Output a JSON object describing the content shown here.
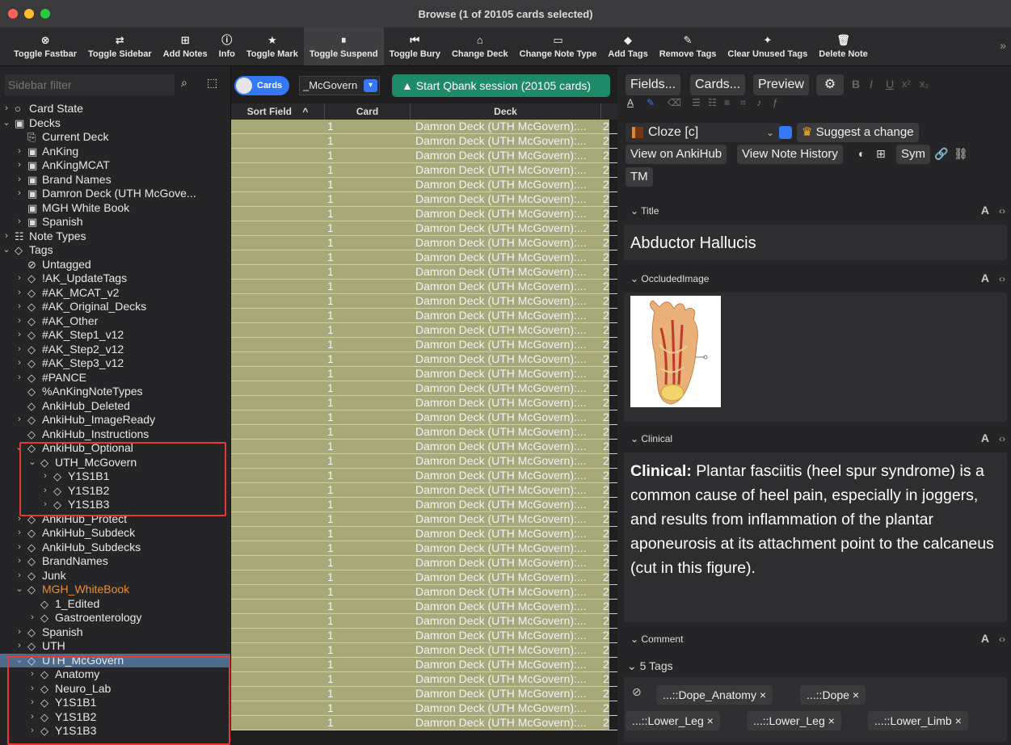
{
  "window": {
    "title": "Browse (1 of 20105 cards selected)"
  },
  "toolbar": {
    "items": [
      {
        "label": "Toggle Fastbar",
        "icon": "x-circle-icon"
      },
      {
        "label": "Toggle Sidebar",
        "icon": "swap-arrows-icon"
      },
      {
        "label": "Add Notes",
        "icon": "plus-square-icon"
      },
      {
        "label": "Info",
        "icon": "info-icon"
      },
      {
        "label": "Toggle Mark",
        "icon": "star-icon"
      },
      {
        "label": "Toggle Suspend",
        "icon": "pause-circle-icon"
      },
      {
        "label": "Toggle Bury",
        "icon": "skip-back-icon"
      },
      {
        "label": "Change Deck",
        "icon": "inbox-icon"
      },
      {
        "label": "Change Note Type",
        "icon": "note-type-icon"
      },
      {
        "label": "Add Tags",
        "icon": "tag-icon"
      },
      {
        "label": "Remove Tags",
        "icon": "eraser-icon"
      },
      {
        "label": "Clear Unused Tags",
        "icon": "magic-wand-icon"
      },
      {
        "label": "Delete Note",
        "icon": "trash-icon"
      }
    ]
  },
  "sidebar": {
    "filter_placeholder": "Sidebar filter",
    "items": [
      {
        "label": "Card State",
        "depth": 0,
        "chev": "right",
        "icon": "circle-icon"
      },
      {
        "label": "Decks",
        "depth": 0,
        "chev": "down",
        "icon": "deck-icon"
      },
      {
        "label": "Current Deck",
        "depth": 1,
        "chev": "",
        "icon": "current-deck-icon"
      },
      {
        "label": "AnKing",
        "depth": 1,
        "chev": "right",
        "icon": "deck-icon"
      },
      {
        "label": "AnKingMCAT",
        "depth": 1,
        "chev": "right",
        "icon": "deck-icon"
      },
      {
        "label": "Brand Names",
        "depth": 1,
        "chev": "right",
        "icon": "deck-icon"
      },
      {
        "label": "Damron Deck (UTH McGove...",
        "depth": 1,
        "chev": "right",
        "icon": "deck-icon"
      },
      {
        "label": "MGH White Book",
        "depth": 1,
        "chev": "",
        "icon": "deck-icon"
      },
      {
        "label": "Spanish",
        "depth": 1,
        "chev": "right",
        "icon": "deck-icon"
      },
      {
        "label": "Note Types",
        "depth": 0,
        "chev": "right",
        "icon": "note-types-icon"
      },
      {
        "label": "Tags",
        "depth": 0,
        "chev": "down",
        "icon": "tag-icon"
      },
      {
        "label": "Untagged",
        "depth": 1,
        "chev": "",
        "icon": "untagged-icon"
      },
      {
        "label": "!AK_UpdateTags",
        "depth": 1,
        "chev": "right",
        "icon": "tag-icon"
      },
      {
        "label": "#AK_MCAT_v2",
        "depth": 1,
        "chev": "right",
        "icon": "tag-icon"
      },
      {
        "label": "#AK_Original_Decks",
        "depth": 1,
        "chev": "right",
        "icon": "tag-icon"
      },
      {
        "label": "#AK_Other",
        "depth": 1,
        "chev": "right",
        "icon": "tag-icon"
      },
      {
        "label": "#AK_Step1_v12",
        "depth": 1,
        "chev": "right",
        "icon": "tag-icon"
      },
      {
        "label": "#AK_Step2_v12",
        "depth": 1,
        "chev": "right",
        "icon": "tag-icon"
      },
      {
        "label": "#AK_Step3_v12",
        "depth": 1,
        "chev": "right",
        "icon": "tag-icon"
      },
      {
        "label": "#PANCE",
        "depth": 1,
        "chev": "right",
        "icon": "tag-icon"
      },
      {
        "label": "%AnKingNoteTypes",
        "depth": 1,
        "chev": "",
        "icon": "tag-icon"
      },
      {
        "label": "AnkiHub_Deleted",
        "depth": 1,
        "chev": "",
        "icon": "tag-icon"
      },
      {
        "label": "AnkiHub_ImageReady",
        "depth": 1,
        "chev": "right",
        "icon": "tag-icon"
      },
      {
        "label": "AnkiHub_Instructions",
        "depth": 1,
        "chev": "",
        "icon": "tag-icon"
      },
      {
        "label": "AnkiHub_Optional",
        "depth": 1,
        "chev": "down",
        "icon": "tag-icon"
      },
      {
        "label": "UTH_McGovern",
        "depth": 2,
        "chev": "down",
        "icon": "tag-icon"
      },
      {
        "label": "Y1S1B1",
        "depth": 3,
        "chev": "right",
        "icon": "tag-icon"
      },
      {
        "label": "Y1S1B2",
        "depth": 3,
        "chev": "right",
        "icon": "tag-icon"
      },
      {
        "label": "Y1S1B3",
        "depth": 3,
        "chev": "right",
        "icon": "tag-icon"
      },
      {
        "label": "AnkiHub_Protect",
        "depth": 1,
        "chev": "right",
        "icon": "tag-icon"
      },
      {
        "label": "AnkiHub_Subdeck",
        "depth": 1,
        "chev": "right",
        "icon": "tag-icon"
      },
      {
        "label": "AnkiHub_Subdecks",
        "depth": 1,
        "chev": "right",
        "icon": "tag-icon"
      },
      {
        "label": "BrandNames",
        "depth": 1,
        "chev": "right",
        "icon": "tag-icon"
      },
      {
        "label": "Junk",
        "depth": 1,
        "chev": "right",
        "icon": "tag-icon"
      },
      {
        "label": "MGH_WhiteBook",
        "depth": 1,
        "chev": "down",
        "icon": "tag-icon",
        "color": "orange"
      },
      {
        "label": "1_Edited",
        "depth": 2,
        "chev": "",
        "icon": "tag-icon"
      },
      {
        "label": "Gastroenterology",
        "depth": 2,
        "chev": "right",
        "icon": "tag-icon"
      },
      {
        "label": "Spanish",
        "depth": 1,
        "chev": "right",
        "icon": "tag-icon"
      },
      {
        "label": "UTH",
        "depth": 1,
        "chev": "right",
        "icon": "tag-icon"
      },
      {
        "label": "UTH_McGovern",
        "depth": 1,
        "chev": "down",
        "icon": "tag-icon",
        "selected": true
      },
      {
        "label": "Anatomy",
        "depth": 2,
        "chev": "right",
        "icon": "tag-icon"
      },
      {
        "label": "Neuro_Lab",
        "depth": 2,
        "chev": "right",
        "icon": "tag-icon"
      },
      {
        "label": "Y1S1B1",
        "depth": 2,
        "chev": "right",
        "icon": "tag-icon"
      },
      {
        "label": "Y1S1B2",
        "depth": 2,
        "chev": "right",
        "icon": "tag-icon"
      },
      {
        "label": "Y1S1B3",
        "depth": 2,
        "chev": "right",
        "icon": "tag-icon"
      }
    ]
  },
  "cardlist": {
    "toggle_label": "Cards",
    "search_value": "_McGovern",
    "qbank_label": "Start Qbank session (20105 cards)",
    "columns": [
      "Sort Field",
      "Card",
      "Deck"
    ],
    "sort_indicator": "^",
    "row_card": "1",
    "row_deck": "Damron Deck (UTH McGovern):...",
    "row_due": "2",
    "first_row_deck": "Damron Deck (UTH McGovern):...",
    "row_count": 42
  },
  "editor": {
    "buttons": {
      "fields": "Fields...",
      "cards": "Cards...",
      "preview": "Preview"
    },
    "note_type": "Cloze [c]",
    "suggest_label": "Suggest a change",
    "view_on_ankihub": "View on AnkiHub",
    "view_note_history": "View Note History",
    "sym_label": "Sym",
    "tm_label": "TM",
    "fields": [
      {
        "label": "Title",
        "content": "Abductor Hallucis"
      },
      {
        "label": "OccludedImage"
      },
      {
        "label": "Clinical",
        "bold": "Clinical:",
        "content": " Plantar fasciitis (heel spur syndrome) is a common cause of heel pain, especially in joggers, and results from inflammation of the plantar aponeurosis at its attachment point to the calcaneus (cut in this figure)."
      },
      {
        "label": "Comment"
      }
    ],
    "tags_header": "5 Tags",
    "tags": [
      "...::Dope_Anatomy",
      "...::Dope",
      "...::Lower_Leg",
      "...::Lower_Leg",
      "...::Lower_Limb"
    ],
    "tag_remove": "×"
  },
  "colors": {
    "accent": "#3478f6",
    "qbank": "#1f8a6a",
    "row_bg": "#a8a97a",
    "selected": "#4c6b8d",
    "highlight_box": "#e53935",
    "orange_tag": "#f28c28"
  }
}
